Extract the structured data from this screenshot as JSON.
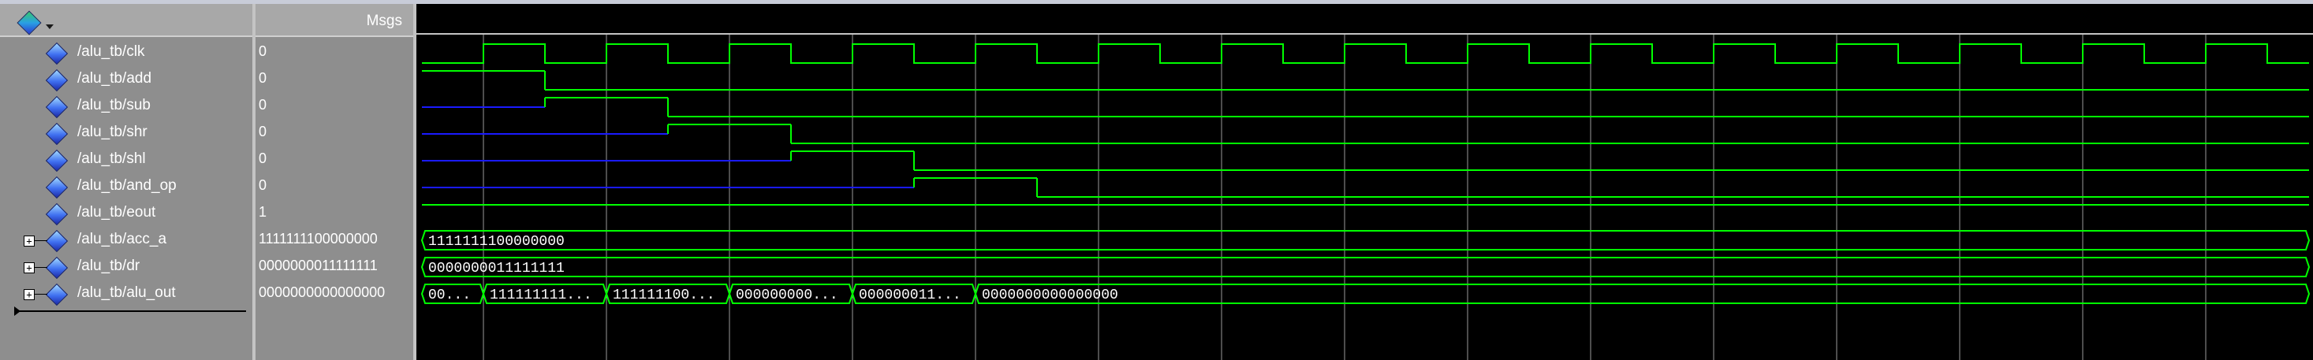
{
  "header": {
    "msgs_label": "Msgs",
    "toolbar_icon": "wave-diamond-icon"
  },
  "colors": {
    "wave": "#00ff00",
    "undriven": "#1a1aff",
    "cursor": "#ffffff",
    "pane": "#8e8e8e"
  },
  "signals": [
    {
      "name": "/alu_tb/clk",
      "value": "0",
      "kind": "clock"
    },
    {
      "name": "/alu_tb/add",
      "value": "0",
      "kind": "bit",
      "transitions": [
        [
          0,
          1
        ],
        [
          1,
          0
        ]
      ]
    },
    {
      "name": "/alu_tb/sub",
      "value": "0",
      "kind": "bit",
      "transitions": [
        [
          0,
          "z"
        ],
        [
          1,
          1
        ],
        [
          2,
          0
        ]
      ]
    },
    {
      "name": "/alu_tb/shr",
      "value": "0",
      "kind": "bit",
      "transitions": [
        [
          0,
          "z"
        ],
        [
          2,
          1
        ],
        [
          3,
          0
        ]
      ]
    },
    {
      "name": "/alu_tb/shl",
      "value": "0",
      "kind": "bit",
      "transitions": [
        [
          0,
          "z"
        ],
        [
          3,
          1
        ],
        [
          4,
          0
        ]
      ]
    },
    {
      "name": "/alu_tb/and_op",
      "value": "0",
      "kind": "bit",
      "transitions": [
        [
          0,
          "z"
        ],
        [
          4,
          1
        ],
        [
          5,
          0
        ]
      ]
    },
    {
      "name": "/alu_tb/eout",
      "value": "1",
      "kind": "bit",
      "transitions": [
        [
          0,
          1
        ]
      ]
    },
    {
      "name": "/alu_tb/acc_a",
      "value": "1111111100000000",
      "kind": "bus",
      "expandable": true,
      "segments": [
        {
          "start": 0,
          "label": "1111111100000000"
        }
      ]
    },
    {
      "name": "/alu_tb/dr",
      "value": "0000000011111111",
      "kind": "bus",
      "expandable": true,
      "segments": [
        {
          "start": 0,
          "label": "0000000011111111"
        }
      ]
    },
    {
      "name": "/alu_tb/alu_out",
      "value": "0000000000000000",
      "kind": "bus",
      "expandable": true,
      "segments": [
        {
          "start": 0,
          "label": "00..."
        },
        {
          "start": 0.5,
          "label": "111111111..."
        },
        {
          "start": 1.5,
          "label": "111111100..."
        },
        {
          "start": 2.5,
          "label": "000000000..."
        },
        {
          "start": 3.5,
          "label": "000000011..."
        },
        {
          "start": 4.5,
          "label": "0000000000000000"
        }
      ]
    }
  ],
  "clock": {
    "cycles": 15.2
  }
}
